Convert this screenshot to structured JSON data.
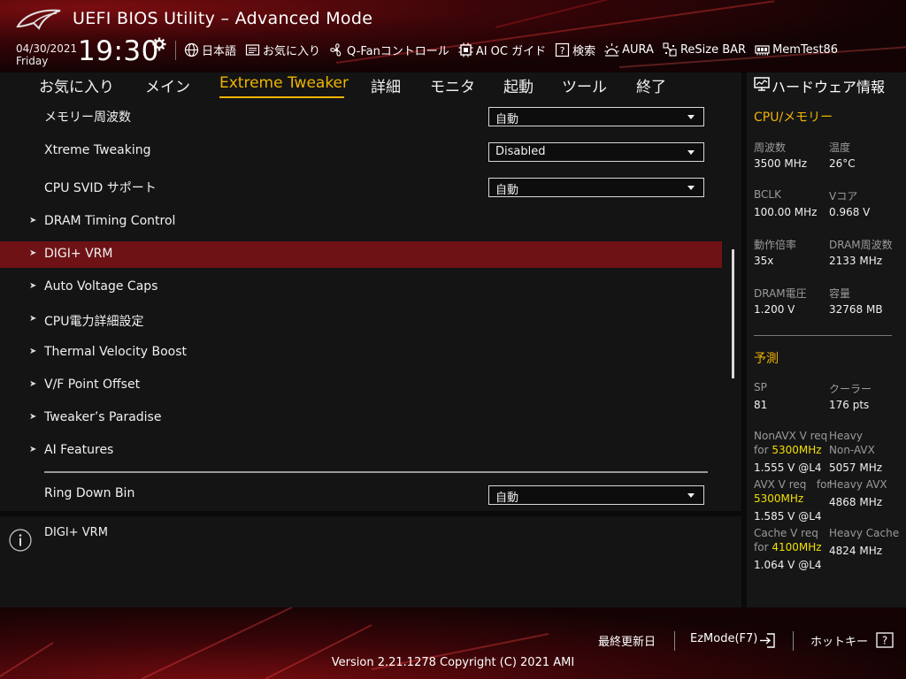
{
  "header": {
    "title": "UEFI BIOS Utility – Advanced Mode",
    "date": "04/30/2021",
    "day": "Friday",
    "time": "19:30",
    "toolbar": [
      {
        "label": "日本語",
        "icon": "globe-icon"
      },
      {
        "label": "お気に入り",
        "icon": "favorites-icon"
      },
      {
        "label": "Q-Fanコントロール",
        "icon": "fan-icon"
      },
      {
        "label": "AI OC ガイド",
        "icon": "ai-oc-icon"
      },
      {
        "label": "検索",
        "icon": "search-help-icon"
      },
      {
        "label": "AURA",
        "icon": "aura-icon"
      },
      {
        "label": "ReSize BAR",
        "icon": "resize-bar-icon"
      },
      {
        "label": "MemTest86",
        "icon": "memtest-icon"
      }
    ]
  },
  "nav": {
    "tabs": [
      "お気に入り",
      "メイン",
      "Extreme Tweaker",
      "詳細",
      "モニタ",
      "起動",
      "ツール",
      "終了"
    ],
    "active": "Extreme Tweaker"
  },
  "settings": [
    {
      "label": "メモリー周波数",
      "value": "自動"
    },
    {
      "label": "Xtreme Tweaking",
      "value": "Disabled"
    },
    {
      "label": "CPU SVID サポート",
      "value": "自動"
    }
  ],
  "submenus": [
    "DRAM Timing Control",
    "DIGI+ VRM",
    "Auto Voltage Caps",
    "CPU電力詳細設定",
    "Thermal Velocity Boost",
    "V/F Point Offset",
    "Tweaker’s Paradise",
    "AI Features"
  ],
  "selected_item": "DIGI+ VRM",
  "ring_down_bin": {
    "label": "Ring Down Bin",
    "value": "自動"
  },
  "help": {
    "text": "DIGI+ VRM"
  },
  "hw": {
    "title": "ハードウェア情報",
    "cpu_section": "CPU/メモリー",
    "cpu": {
      "freq_label": "周波数",
      "freq": "3500 MHz",
      "temp_label": "温度",
      "temp": "26°C",
      "bclk_label": "BCLK",
      "bclk": "100.00 MHz",
      "vcore_label": "Vコア",
      "vcore": "0.968 V",
      "ratio_label": "動作倍率",
      "ratio": "35x",
      "dram_freq_label": "DRAM周波数",
      "dram_freq": "2133 MHz",
      "dram_volt_label": "DRAM電圧",
      "dram_volt": "1.200 V",
      "capacity_label": "容量",
      "capacity": "32768 MB"
    },
    "predict_section": "予測",
    "predict": {
      "sp_label": "SP",
      "sp": "81",
      "cooler_label": "クーラー",
      "cooler": "176 pts",
      "nonavx_label_a": "NonAVX V req",
      "nonavx_label_b": "for",
      "nonavx_freq": "5300MHz",
      "nonavx_v": "1.555 V @L4",
      "heavy_nonavx_a": "Heavy",
      "heavy_nonavx_b": "Non-AVX",
      "heavy_nonavx_v": "5057 MHz",
      "avx_label_a": "AVX V req",
      "avx_label_b": "for",
      "avx_freq": "5300MHz",
      "avx_v": "1.585 V @L4",
      "heavy_avx_label": "Heavy AVX",
      "heavy_avx_v": "4868 MHz",
      "cache_label_a": "Cache V req",
      "cache_label_b": "for",
      "cache_freq": "4100MHz",
      "cache_v": "1.064 V @L4",
      "heavy_cache_label": "Heavy Cache",
      "heavy_cache_v": "4824 MHz"
    }
  },
  "footer": {
    "last_modified": "最終更新日",
    "ezmode": "EzMode(F7)",
    "hotkeys": "ホットキー",
    "hotkey_glyph": "?",
    "version": "Version 2.21.1278 Copyright (C) 2021 AMI"
  },
  "colors": {
    "accent": "#f0b400",
    "selected_row": "#6e1216",
    "highlight": "#f0e000"
  }
}
